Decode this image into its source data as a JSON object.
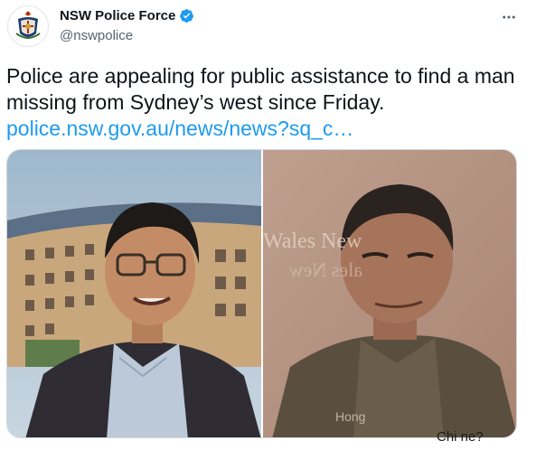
{
  "account": {
    "display_name": "NSW Police Force",
    "handle": "@nswpolice",
    "verified": true,
    "avatar_icon": "nsw-police-crest-icon"
  },
  "tweet": {
    "text": "Police are appealing for public assistance to find a man missing from Sydney’s west since Friday.",
    "link_text": "police.nsw.gov.au/news/news?sq_c…"
  },
  "media": {
    "right_photo_text": {
      "line1": "Wales New",
      "line2": "ales New",
      "line3": "Hong"
    }
  },
  "watermark": "Chi ne?",
  "colors": {
    "link": "#1d9bf0",
    "verified": "#1d9bf0",
    "text": "#0f1419",
    "secondary": "#536471"
  }
}
